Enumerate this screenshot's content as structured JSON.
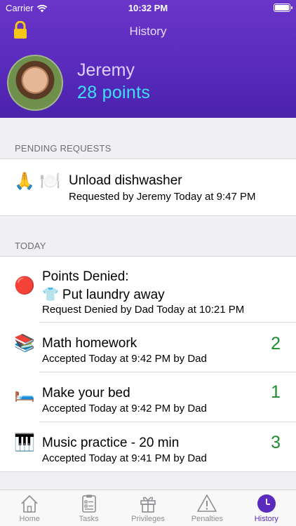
{
  "status": {
    "carrier": "Carrier",
    "time": "10:32 PM"
  },
  "nav": {
    "title": "History"
  },
  "user": {
    "name": "Jeremy",
    "points": "28 points"
  },
  "pending": {
    "header": "PENDING REQUESTS",
    "items": [
      {
        "emoji": "🙏 🍽️",
        "title": "Unload dishwasher",
        "subtitle": "Requested by Jeremy Today at 9:47 PM"
      }
    ]
  },
  "today": {
    "header": "TODAY",
    "items": [
      {
        "emoji": "🔴",
        "title_line1": "Points Denied:",
        "title_line2": "👕 Put laundry away",
        "subtitle": "Request Denied by Dad Today at 10:21 PM",
        "value": ""
      },
      {
        "emoji": "📚",
        "title": "Math homework",
        "subtitle": "Accepted Today at 9:42 PM by Dad",
        "value": "2"
      },
      {
        "emoji": "🛏️",
        "title": "Make your bed",
        "subtitle": "Accepted Today at 9:42 PM by Dad",
        "value": "1"
      },
      {
        "emoji": "🎹",
        "title": "Music practice - 20 min",
        "subtitle": "Accepted Today at 9:41 PM by Dad",
        "value": "3"
      }
    ]
  },
  "tabs": [
    {
      "label": "Home",
      "icon": "home-icon"
    },
    {
      "label": "Tasks",
      "icon": "tasks-icon"
    },
    {
      "label": "Privileges",
      "icon": "gift-icon"
    },
    {
      "label": "Penalties",
      "icon": "warning-icon"
    },
    {
      "label": "History",
      "icon": "clock-icon",
      "active": true
    }
  ],
  "colors": {
    "header": "#5a2bbd",
    "points": "#3ee0ff",
    "value": "#1f8c2e",
    "active_tab": "#5a2bbd"
  }
}
